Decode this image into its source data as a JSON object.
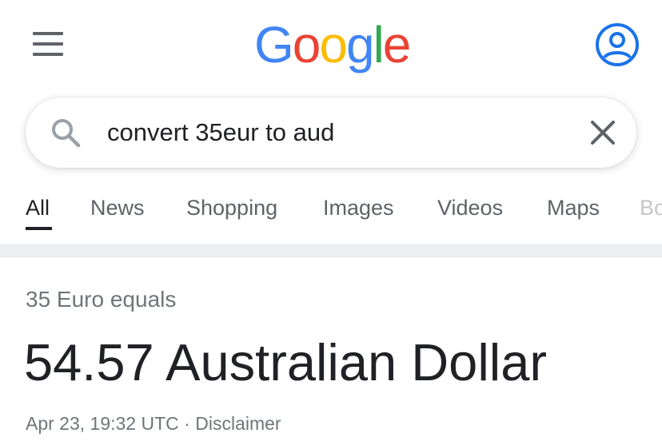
{
  "header": {
    "logo_letters": [
      {
        "char": "G",
        "color": "#4285F4"
      },
      {
        "char": "o",
        "color": "#EA4335"
      },
      {
        "char": "o",
        "color": "#FBBC05"
      },
      {
        "char": "g",
        "color": "#4285F4"
      },
      {
        "char": "l",
        "color": "#34A853"
      },
      {
        "char": "e",
        "color": "#EA4335"
      }
    ],
    "menu_icon": "hamburger-menu-icon",
    "account_icon": "account-circle-icon",
    "account_color": "#1A73E8"
  },
  "search": {
    "query": "convert 35eur to aud",
    "search_icon": "magnifier-icon",
    "clear_icon": "close-icon"
  },
  "tabs": [
    {
      "label": "All",
      "active": true
    },
    {
      "label": "News",
      "active": false
    },
    {
      "label": "Shopping",
      "active": false
    },
    {
      "label": "Images",
      "active": false
    },
    {
      "label": "Videos",
      "active": false
    },
    {
      "label": "Maps",
      "active": false
    },
    {
      "label": "Bo",
      "active": false
    }
  ],
  "result": {
    "label": "35 Euro equals",
    "value": "54.57 Australian Dollar",
    "timestamp": "Apr 23, 19:32 UTC",
    "separator": "·",
    "disclaimer": "Disclaimer"
  }
}
